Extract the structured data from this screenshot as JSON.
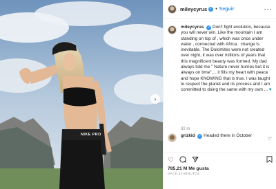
{
  "post": {
    "username": "mileycyrus",
    "follow_label": "Seguir",
    "separator": "•",
    "caption_user": "mileycyrus",
    "caption_text": "Don't fight evolution, because you will never win. Like the mountain I am standing on top of , which was once under water , connected with Africa . change is inevitable. The Dolomites were not created over night, it was over millions of years that this magnificent beauty was formed. My dad always told me \" Nature never hurries but it is always on time\".... it fills my heart with peace and hope KNOWING that is true. I was taught to respect the planet and its process and I am committed to doing the same with my own ...",
    "caption_age": "32 m",
    "likes": "785,21 M Me gusta",
    "posted_ago": "HACE 32 MINUTOS"
  },
  "comments": [
    {
      "username": "grizkid",
      "text": "Headed there in October"
    }
  ],
  "photo": {
    "shorts_label": "NIKE PRO"
  },
  "icons": {
    "verified": "verified-badge",
    "more": "more-options-icon",
    "like": "heart-icon",
    "comment": "comment-icon",
    "share": "share-icon",
    "save": "bookmark-icon",
    "next": "chevron-right-icon",
    "caption_heart": "blue-heart-emoji",
    "comment_like": "small-heart-icon"
  },
  "colors": {
    "link": "#3897f0",
    "verified": "#3897f0",
    "caption_heart": "#1e8fa3"
  }
}
